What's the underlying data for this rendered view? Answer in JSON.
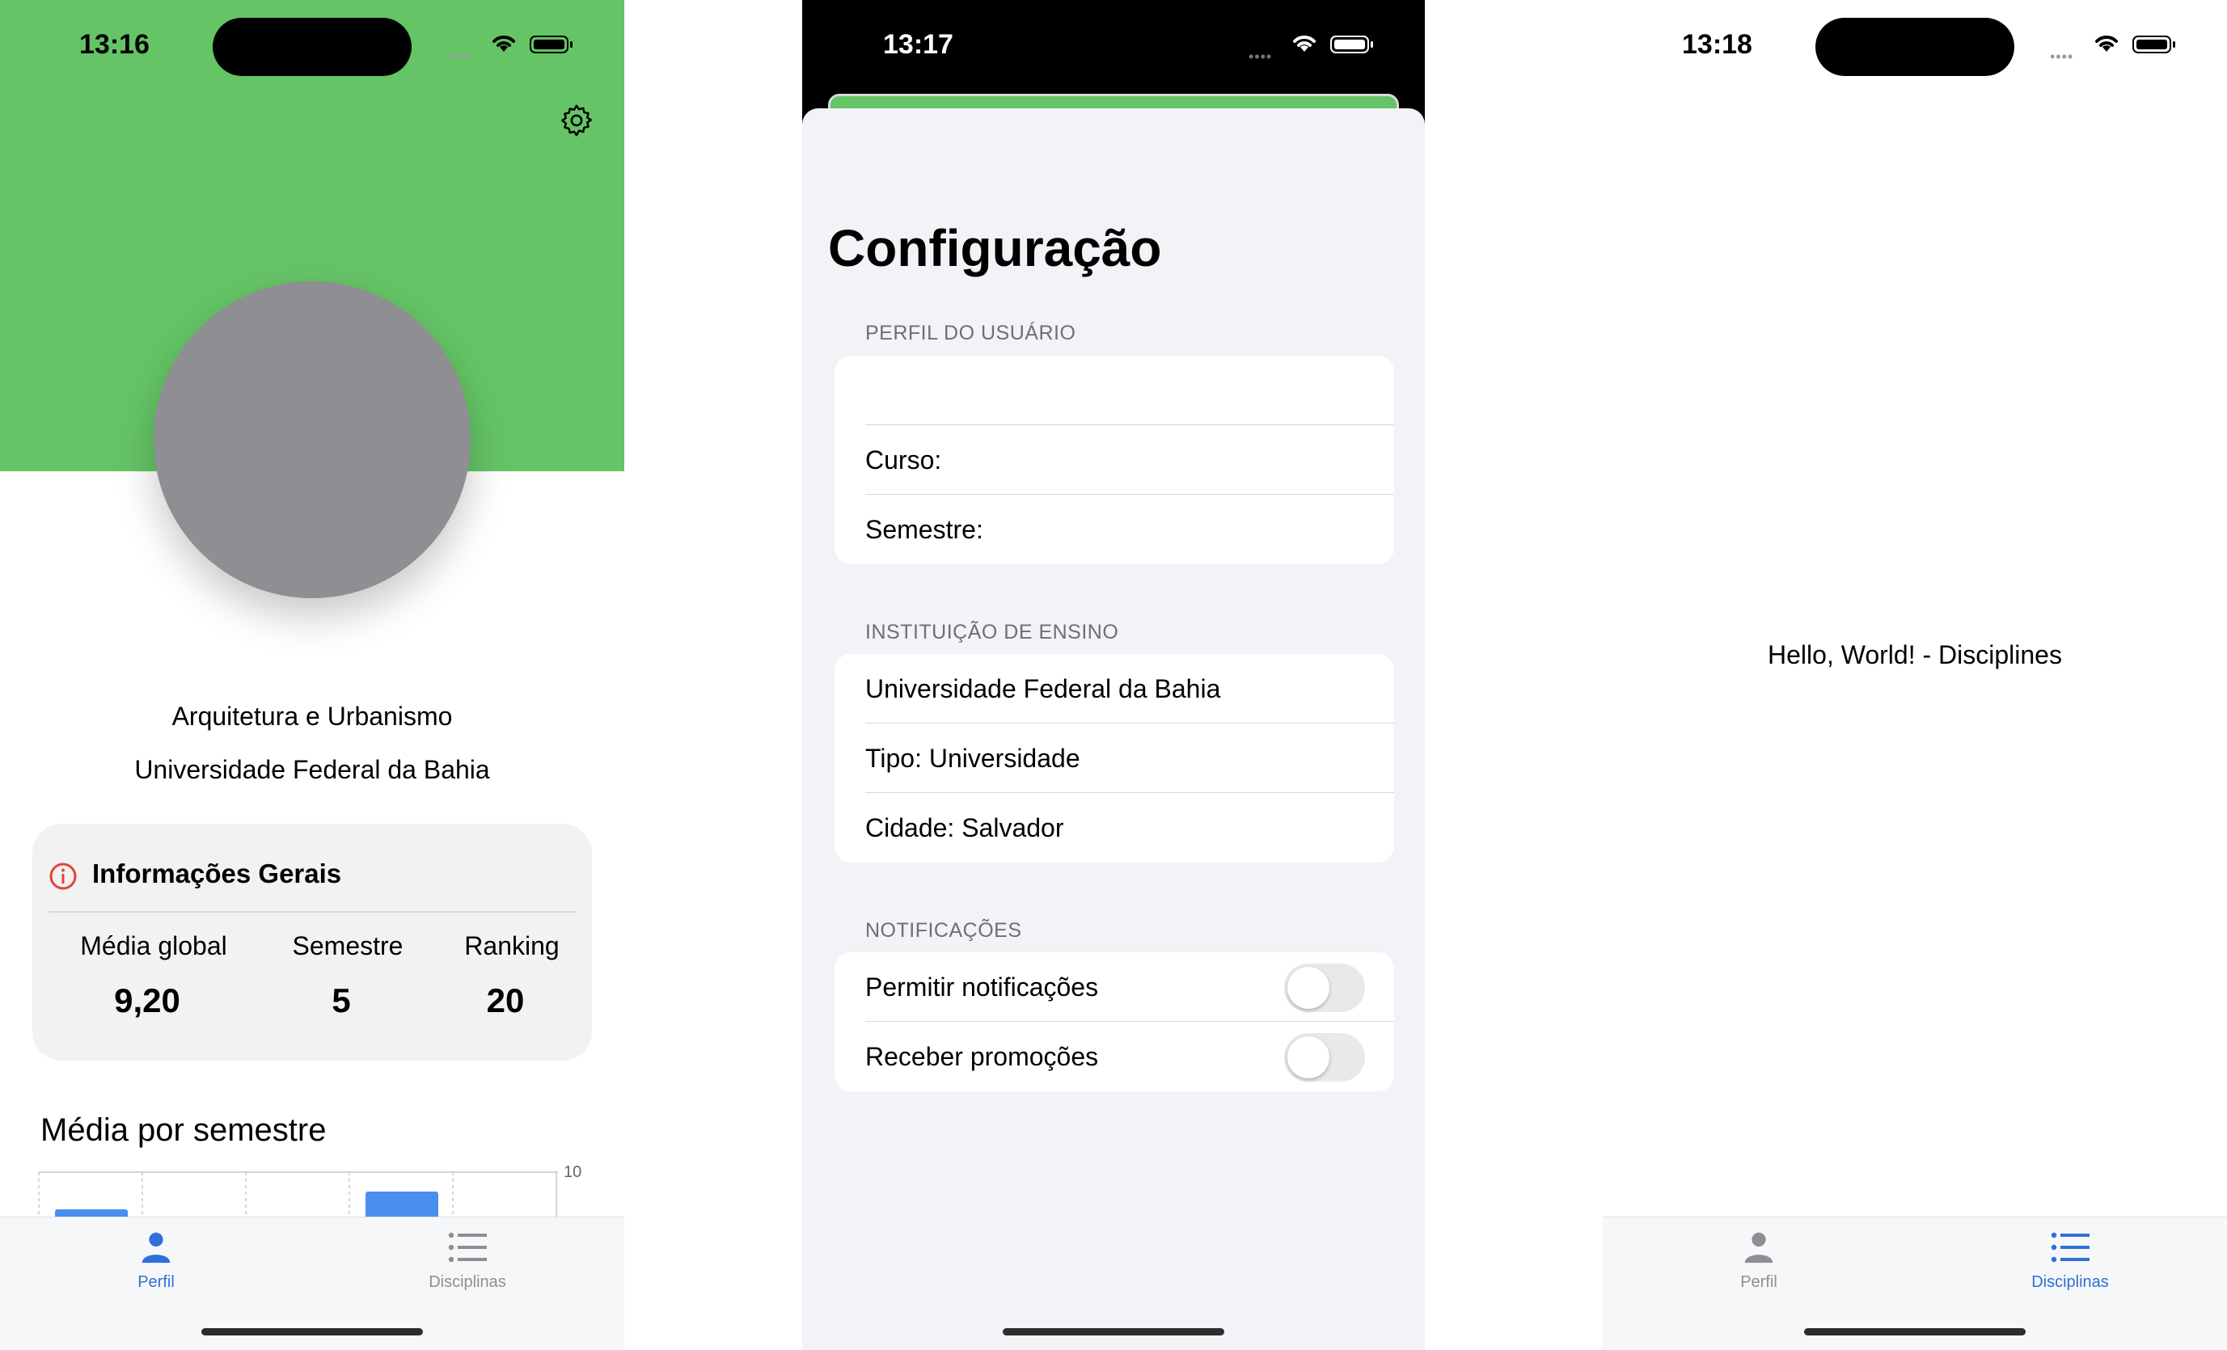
{
  "profile_screen": {
    "status_time": "13:16",
    "course": "Arquitetura e Urbanismo",
    "university": "Universidade Federal da Bahia",
    "info_card": {
      "title": "Informações Gerais",
      "stats": [
        {
          "label": "Média global",
          "value": "9,20"
        },
        {
          "label": "Semestre",
          "value": "5"
        },
        {
          "label": "Ranking",
          "value": "20"
        }
      ]
    },
    "chart_title": "Média por semestre",
    "chart_data": {
      "type": "bar",
      "ylim": [
        0,
        10
      ],
      "y_tick_labels": [
        "10"
      ],
      "grid": true,
      "note": "chart partially hidden behind tab bar"
    },
    "tabs": [
      {
        "label": "Perfil",
        "icon": "person-icon",
        "active": true
      },
      {
        "label": "Disciplinas",
        "icon": "list-icon",
        "active": false
      }
    ]
  },
  "settings_screen": {
    "status_time": "13:17",
    "title": "Configuração",
    "sections": [
      {
        "header": "PERFIL DO USUÁRIO",
        "rows": [
          "",
          "Curso:",
          "Semestre:"
        ]
      },
      {
        "header": "INSTITUIÇÃO DE ENSINO",
        "rows": [
          "Universidade Federal da Bahia",
          "Tipo: Universidade",
          "Cidade: Salvador"
        ]
      },
      {
        "header": "NOTIFICAÇÕES",
        "rows": [
          {
            "label": "Permitir notificações",
            "on": false
          },
          {
            "label": "Receber promoções",
            "on": false
          }
        ]
      }
    ]
  },
  "disciplines_screen": {
    "status_time": "13:18",
    "message": "Hello, World! - Disciplines",
    "tabs": [
      {
        "label": "Perfil",
        "icon": "person-icon",
        "active": false
      },
      {
        "label": "Disciplinas",
        "icon": "list-icon",
        "active": true
      }
    ]
  },
  "colors": {
    "header_green": "#65c466",
    "accent_blue": "#2f6fd8",
    "bar_blue": "#4a8ff0",
    "avatar_gray": "#8e8e93",
    "info_red": "#e0453a"
  }
}
